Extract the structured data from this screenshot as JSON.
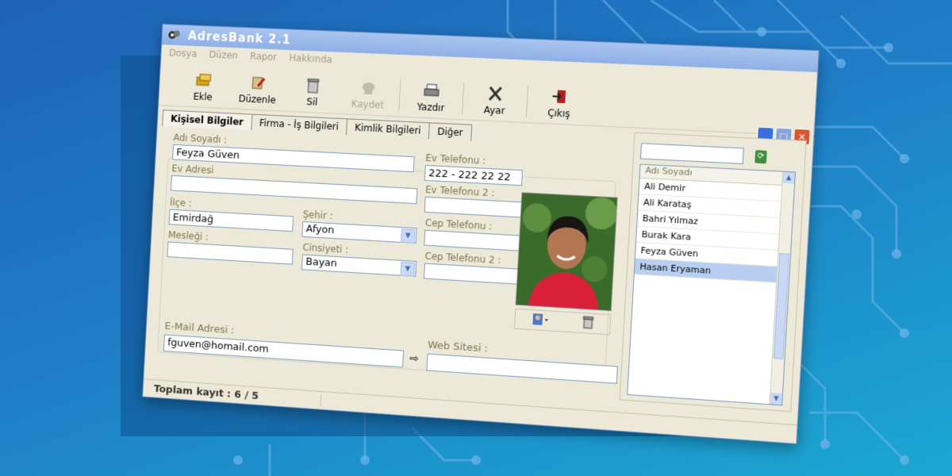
{
  "window": {
    "title": "AdresBank 2.1"
  },
  "menu": [
    "Dosya",
    "Düzen",
    "Rapor",
    "Hakkında"
  ],
  "toolbar": {
    "ekle": "Ekle",
    "duzenle": "Düzenle",
    "sil": "Sil",
    "kaydet": "Kaydet",
    "yazdir": "Yazdır",
    "ayar": "Ayar",
    "cikis": "Çıkış"
  },
  "tabs": [
    "Kişisel Bilgiler",
    "Firma - İş Bilgileri",
    "Kimlik Bilgileri",
    "Diğer"
  ],
  "form": {
    "adi_soyadi_label": "Adı Soyadı :",
    "adi_soyadi": "Feyza Güven",
    "ev_adresi_label": "Ev Adresi",
    "ev_adresi": "",
    "ilce_label": "İlçe :",
    "ilce": "Emirdağ",
    "sehir_label": "Şehir :",
    "sehir": "Afyon",
    "meslegi_label": "Mesleği :",
    "meslegi": "",
    "cinsiyeti_label": "Cinsiyeti :",
    "cinsiyeti": "Bayan",
    "ev_tel_label": "Ev Telefonu :",
    "ev_tel": "222 - 222 22 22",
    "ev_tel2_label": "Ev Telefonu 2 :",
    "ev_tel2": "",
    "cep_tel_label": "Cep Telefonu :",
    "cep_tel": "",
    "cep_tel2_label": "Cep Telefonu 2 :",
    "cep_tel2": "",
    "email_label": "E-Mail Adresi :",
    "email": "fguven@homail.com",
    "web_label": "Web Sitesi :",
    "web": ""
  },
  "list": {
    "search_value": "",
    "header": "Adı Soyadı",
    "items": [
      "Ali Demir",
      "Ali Karataş",
      "Bahri Yılmaz",
      "Burak Kara",
      "Feyza Güven",
      "Hasan Eryaman"
    ],
    "selected": "Hasan Eryaman"
  },
  "status": {
    "total": "Toplam kayıt : 6 / 5"
  }
}
